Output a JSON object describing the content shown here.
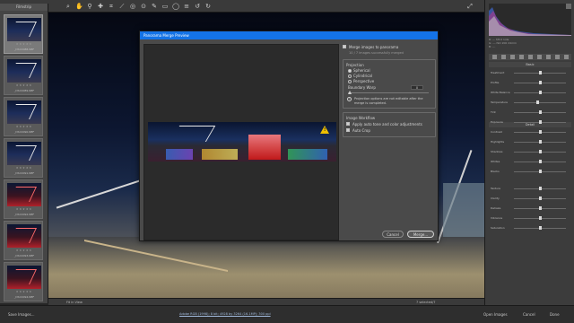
{
  "filmstrip": {
    "header": "Filmstrip",
    "items": [
      {
        "name": "_DSC0088.NEF",
        "stars": "★★★★★",
        "red": false
      },
      {
        "name": "_DSC0089.NEF",
        "stars": "★★★★★",
        "red": false
      },
      {
        "name": "_DSC0090.NEF",
        "stars": "★★★★★",
        "red": false
      },
      {
        "name": "_DSC0091.NEF",
        "stars": "★★★★★",
        "red": false
      },
      {
        "name": "_DSC0092.NEF",
        "stars": "★★★★★",
        "red": true
      },
      {
        "name": "_DSC0093.NEF",
        "stars": "★★★★★",
        "red": true
      },
      {
        "name": "_DSC0094.NEF",
        "stars": "★★★★★",
        "red": true
      }
    ]
  },
  "dialog": {
    "title": "Panorama Merge Preview",
    "merge_images": "Merge images to panorama",
    "merge_note": "10 / 7 images successfully merged",
    "projection": {
      "title": "Projection",
      "options": [
        "Spherical",
        "Cylindrical",
        "Perspective"
      ],
      "selected": "Spherical"
    },
    "boundary": {
      "label": "Boundary Warp",
      "value": "0",
      "fraction": 0.0
    },
    "info_text": "Projection options are not editable after the merge is completed.",
    "workflow": {
      "title": "Image Workflow",
      "auto_tone": "Apply auto tone and color adjustments",
      "auto_crop": "Auto Crop"
    },
    "cancel": "Cancel",
    "merge": "Merge..."
  },
  "right_panel": {
    "readout": [
      "R: --- f/8.0 1/4s",
      "G: --- ISO 200 24mm",
      "B: ---"
    ],
    "basic_header": "Basic",
    "section_header": "Detail",
    "rows": [
      {
        "label": "Treatment",
        "value": 0.5
      },
      {
        "label": "Profile",
        "value": 0.5
      },
      {
        "label": "White Balance",
        "value": 0.5
      },
      {
        "label": "Temperature",
        "value": 0.45
      },
      {
        "label": "Tint",
        "value": 0.5
      },
      {
        "label": "Exposure",
        "value": 0.5
      },
      {
        "label": "Contrast",
        "value": 0.5
      },
      {
        "label": "Highlights",
        "value": 0.5
      },
      {
        "label": "Shadows",
        "value": 0.5
      },
      {
        "label": "Whites",
        "value": 0.5
      },
      {
        "label": "Blacks",
        "value": 0.5
      },
      {
        "label": "Texture",
        "value": 0.5
      },
      {
        "label": "Clarity",
        "value": 0.5
      },
      {
        "label": "Dehaze",
        "value": 0.5
      },
      {
        "label": "Vibrance",
        "value": 0.5
      },
      {
        "label": "Saturation",
        "value": 0.5
      }
    ]
  },
  "bottom": {
    "zoom": "Fit in View",
    "status": "7 selected/7",
    "select_images": "Save Images...",
    "link_text": "Adobe RGB (1998); 8 bit; 4928 by 3264 (16.1MP); 300 ppi",
    "open_images": "Open Images",
    "cancel": "Cancel",
    "done": "Done"
  }
}
